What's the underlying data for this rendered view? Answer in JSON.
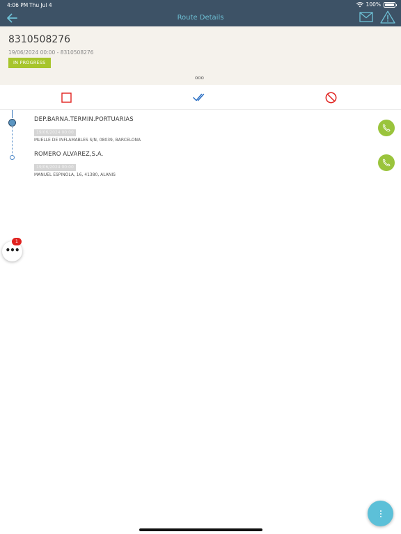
{
  "status_bar": {
    "time": "4:06 PM",
    "date": "Thu Jul 4",
    "battery": "100%"
  },
  "nav": {
    "title": "Route Details"
  },
  "route": {
    "id": "8310508276",
    "subtitle": "19/06/2024 00:00 - 8310508276",
    "status": "IN PROGRESS"
  },
  "header": {
    "more_label": "ooo"
  },
  "stops": [
    {
      "name": "DEP.BARNA.TERMIN.PORTUARIAS",
      "date": "19/06/2024 00:00",
      "address": "MUELLE DE INFLAMABLES S/N, 08039, BARCELONA"
    },
    {
      "name": "ROMERO ALVAREZ,S.A.",
      "date": "19/06/2024 00:00",
      "address": "MANUEL ESPINOLA, 16, 41380, ALANIS"
    }
  ],
  "fab": {
    "more_label": "•••",
    "badge_count": "1"
  },
  "colors": {
    "nav_bar": "#3d5266",
    "accent": "#6ec1d6",
    "status_green": "#a7c52c",
    "call_green": "#9ac43c",
    "danger_red": "#e0221f",
    "check_blue": "#2a6fc4"
  }
}
